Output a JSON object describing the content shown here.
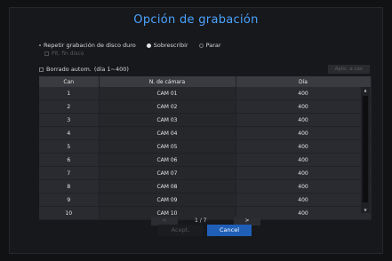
{
  "dialog": {
    "title": "Opción de grabación",
    "repeat_label": "Repetir grabación de disco duro",
    "overwrite_label": "Sobrescribir",
    "stop_label": "Parar",
    "selected_mode": "Sobrescribir",
    "end_disk_label": "Pit. fin disco",
    "auto_delete_label": "Borrado autom.",
    "auto_delete_range": "(día 1~400)",
    "apply_label": "Aplic. a cán"
  },
  "table": {
    "headers": [
      "Can",
      "N. de cámara",
      "Día"
    ],
    "rows": [
      [
        "1",
        "CAM 01",
        "400"
      ],
      [
        "2",
        "CAM 02",
        "400"
      ],
      [
        "3",
        "CAM 03",
        "400"
      ],
      [
        "4",
        "CAM 04",
        "400"
      ],
      [
        "5",
        "CAM 05",
        "400"
      ],
      [
        "6",
        "CAM 06",
        "400"
      ],
      [
        "7",
        "CAM 07",
        "400"
      ],
      [
        "8",
        "CAM 08",
        "400"
      ],
      [
        "9",
        "CAM 09",
        "400"
      ],
      [
        "10",
        "CAM 10",
        "400"
      ]
    ]
  },
  "pager": {
    "prev": "<",
    "next": ">",
    "text": "1 / 7"
  },
  "footer": {
    "accept": "Acept.",
    "cancel": "Cancel"
  },
  "colors": {
    "accent": "#4aa3ff",
    "cancel_bg": "#1f5fb8"
  }
}
